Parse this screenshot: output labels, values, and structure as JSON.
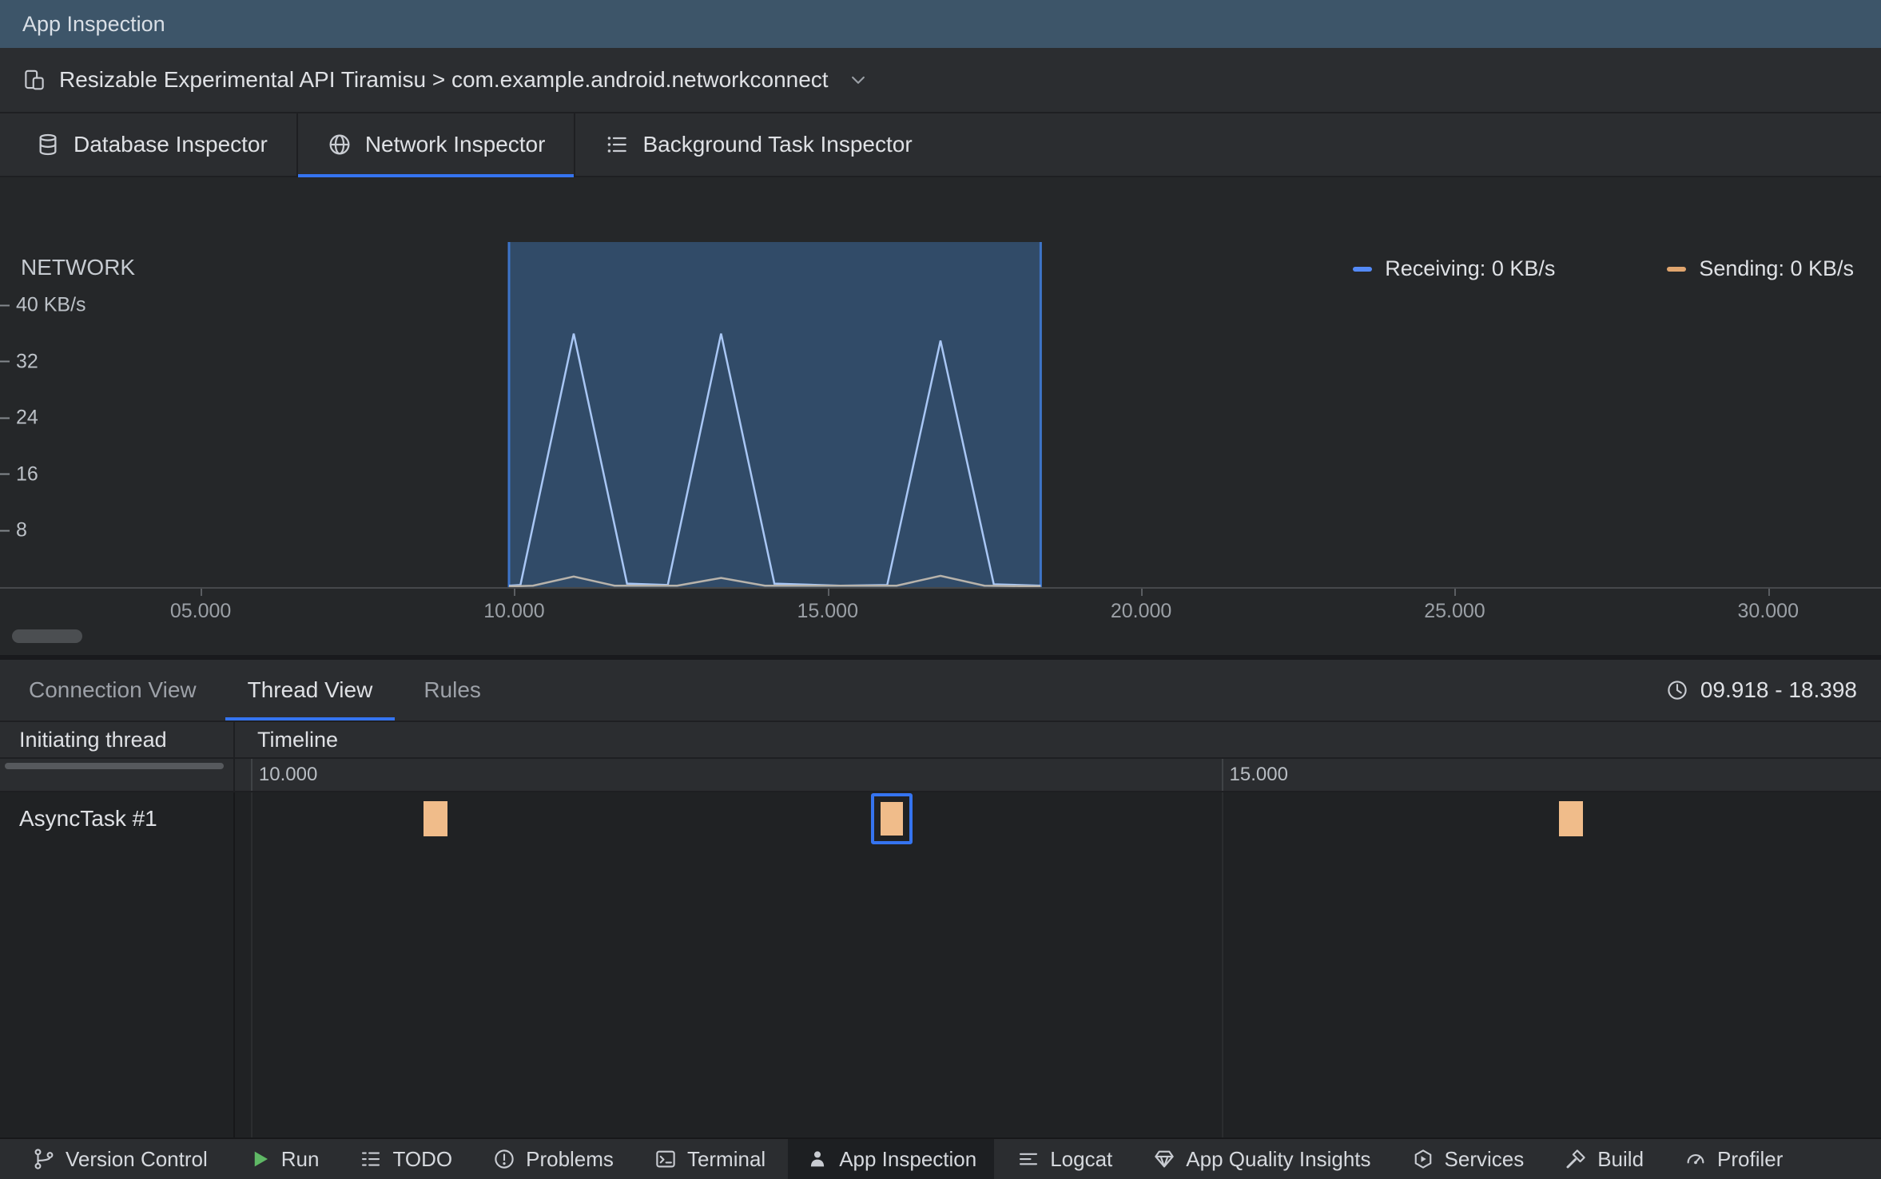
{
  "colors": {
    "accent": "#3574F0",
    "run_green": "#5FB865"
  },
  "window": {
    "title": "App Inspection"
  },
  "device_bar": {
    "label": "Resizable Experimental API Tiramisu > com.example.android.networkconnect"
  },
  "inspector_tabs": [
    {
      "label": "Database Inspector",
      "icon": "database-icon",
      "active": false
    },
    {
      "label": "Network Inspector",
      "icon": "globe-icon",
      "active": true
    },
    {
      "label": "Background Task Inspector",
      "icon": "checklist-icon",
      "active": false
    }
  ],
  "chart_data": {
    "type": "area",
    "title": "NETWORK",
    "unit": "KB/s",
    "legend": [
      {
        "label": "Receiving: 0 KB/s",
        "color": "#548AF7"
      },
      {
        "label": "Sending: 0 KB/s",
        "color": "#E0A56E"
      }
    ],
    "x_range": [
      1.8,
      31.8
    ],
    "y_range": [
      0,
      49
    ],
    "y_ticks": [
      {
        "label": "40 KB/s",
        "value": 40
      },
      {
        "label": "32",
        "value": 32
      },
      {
        "label": "24",
        "value": 24
      },
      {
        "label": "16",
        "value": 16
      },
      {
        "label": "8",
        "value": 8
      }
    ],
    "x_ticks": [
      {
        "label": "05.000",
        "time": 5
      },
      {
        "label": "10.000",
        "time": 10
      },
      {
        "label": "15.000",
        "time": 15
      },
      {
        "label": "20.000",
        "time": 20
      },
      {
        "label": "25.000",
        "time": 25
      },
      {
        "label": "30.000",
        "time": 30
      }
    ],
    "selection": {
      "start": 9.918,
      "end": 18.398,
      "fill": "rgba(77,148,235,0.33)",
      "border": "#3D74C8"
    },
    "series": [
      {
        "name": "Receiving",
        "line_color": "#A9C7F5",
        "points": [
          [
            9.918,
            0.2
          ],
          [
            10.1,
            0.3
          ],
          [
            10.95,
            36
          ],
          [
            11.8,
            0.5
          ],
          [
            12.45,
            0.3
          ],
          [
            13.3,
            36
          ],
          [
            14.15,
            0.5
          ],
          [
            15.2,
            0.2
          ],
          [
            15.95,
            0.3
          ],
          [
            16.8,
            35
          ],
          [
            17.65,
            0.4
          ],
          [
            18.398,
            0.2
          ]
        ]
      },
      {
        "name": "Sending",
        "line_color": "#B8B3AB",
        "points": [
          [
            9.918,
            0.1
          ],
          [
            10.3,
            0.2
          ],
          [
            10.95,
            1.5
          ],
          [
            11.6,
            0.2
          ],
          [
            12.6,
            0.2
          ],
          [
            13.3,
            1.3
          ],
          [
            14.0,
            0.2
          ],
          [
            16.1,
            0.2
          ],
          [
            16.8,
            1.6
          ],
          [
            17.5,
            0.2
          ],
          [
            18.398,
            0.1
          ]
        ]
      }
    ]
  },
  "detail_tabs": [
    {
      "label": "Connection View",
      "active": false
    },
    {
      "label": "Thread View",
      "active": true
    },
    {
      "label": "Rules",
      "active": false
    }
  ],
  "time_range": {
    "text": "09.918 - 18.398"
  },
  "thread_table": {
    "columns": [
      "Initiating thread",
      "Timeline"
    ],
    "range": [
      9.918,
      18.398
    ],
    "ruler_ticks": [
      {
        "label": "10.000",
        "time": 10
      },
      {
        "label": "15.000",
        "time": 15
      }
    ],
    "rows": [
      {
        "name": "AsyncTask #1",
        "event_color": "#F0BC8A",
        "events": [
          {
            "time": 10.95,
            "selected": false
          },
          {
            "time": 13.3,
            "selected": true
          },
          {
            "time": 16.8,
            "selected": false
          }
        ]
      }
    ]
  },
  "bottom_bar": {
    "items": [
      {
        "label": "Version Control",
        "icon": "branch-icon",
        "active": false
      },
      {
        "label": "Run",
        "icon": "play-icon",
        "active": false
      },
      {
        "label": "TODO",
        "icon": "todo-list-icon",
        "active": false
      },
      {
        "label": "Problems",
        "icon": "error-circle-icon",
        "active": false
      },
      {
        "label": "Terminal",
        "icon": "terminal-icon",
        "active": false
      },
      {
        "label": "App Inspection",
        "icon": "inspector-icon",
        "active": true
      },
      {
        "label": "Logcat",
        "icon": "logcat-icon",
        "active": false
      },
      {
        "label": "App Quality Insights",
        "icon": "gem-icon",
        "active": false
      },
      {
        "label": "Services",
        "icon": "hexagon-icon",
        "active": false
      },
      {
        "label": "Build",
        "icon": "hammer-icon",
        "active": false
      },
      {
        "label": "Profiler",
        "icon": "gauge-icon",
        "active": false
      }
    ]
  }
}
